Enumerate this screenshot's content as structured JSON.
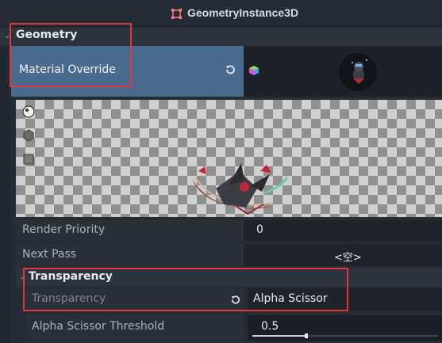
{
  "header": {
    "title": "GeometryInstance3D",
    "icon": "geometry-node-icon",
    "icon_color": "#fc7f7f"
  },
  "geometry_section": {
    "title": "Geometry",
    "material_override": {
      "label": "Material Override",
      "revert_icon": "revert-icon",
      "resource_icon": "material-cube-icon",
      "thumbnail": "material-preview-thumbnail"
    },
    "preview": {
      "buttons": [
        "sphere-icon",
        "hexagon-icon",
        "box-icon"
      ]
    },
    "render_priority": {
      "label": "Render Priority",
      "value": "0"
    },
    "next_pass": {
      "label": "Next Pass",
      "value": "<空>"
    }
  },
  "transparency_section": {
    "title": "Transparency",
    "transparency": {
      "label": "Transparency",
      "value": "Alpha Scissor"
    },
    "alpha_scissor_threshold": {
      "label": "Alpha Scissor Threshold",
      "value": "0.5",
      "fraction": 0.5
    }
  },
  "colors": {
    "highlight": "#e0383e",
    "selected_row": "#4a6a8e",
    "background": "#222831"
  }
}
